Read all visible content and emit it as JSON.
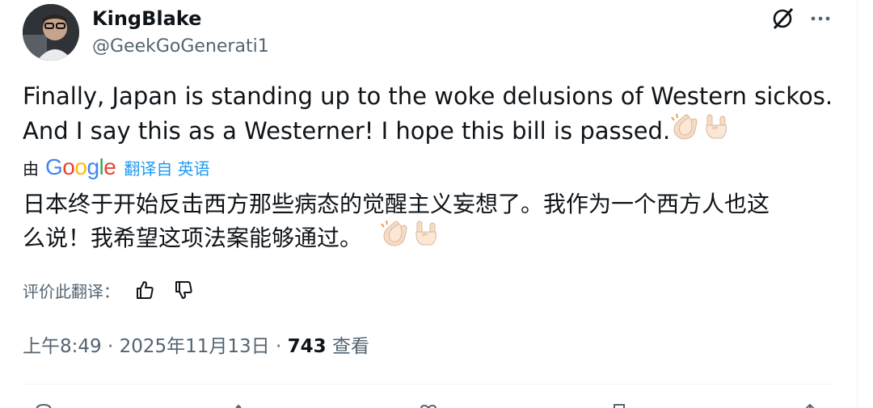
{
  "author": {
    "name": "KingBlake",
    "handle": "@GeekGoGenerati1"
  },
  "tweet": {
    "lines": [
      "Finally, Japan is standing up to the woke delusions of Western sickos.",
      "And I say this as a Westerner! I hope this bill is passed."
    ],
    "emojis": [
      "clapping-hands-emoji",
      "sign-of-horns-emoji"
    ]
  },
  "translation": {
    "by_label": "由",
    "provider": "Google",
    "link_text": "翻译自 英语",
    "lines": [
      "日本终于开始反击西方那些病态的觉醒主义妄想了。我作为一个西方人也这",
      "么说！我希望这项法案能够通过。"
    ],
    "rate_label": "评价此翻译："
  },
  "meta": {
    "time": "上午8:49",
    "separator": "·",
    "date": "2025年11月13日",
    "views_count": "743",
    "views_label": "查看"
  },
  "icons": {
    "grok": "grok-icon",
    "more": "more-icon",
    "thumbs_up": "thumbs-up-icon",
    "thumbs_down": "thumbs-down-icon"
  },
  "colors": {
    "text_primary": "#0f1419",
    "text_secondary": "#536471",
    "link": "#1d9bf0",
    "google_blue": "#4285f4",
    "google_red": "#ea4335",
    "google_yellow": "#fbbc05",
    "google_green": "#34a853"
  }
}
